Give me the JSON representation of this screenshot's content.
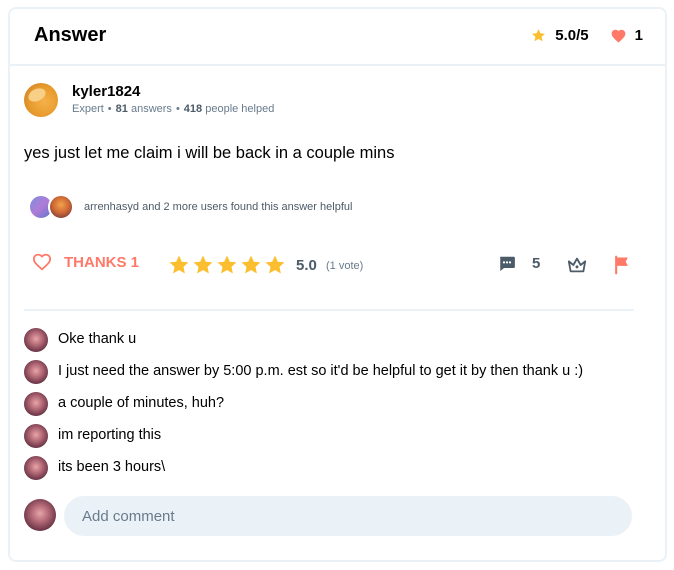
{
  "header": {
    "title": "Answer",
    "rating": "5.0/5",
    "thanks_count": "1",
    "star_color": "#fbbe2e",
    "heart_color": "#ff7968"
  },
  "author": {
    "name": "kyler1824",
    "rank": "Expert",
    "answers_count": "81",
    "answers_label": "answers",
    "helped_count": "418",
    "helped_label": "people helped"
  },
  "answer": {
    "text": "yes just let me claim i will be back in a couple mins"
  },
  "helpful": {
    "text": "arrenhasyd and 2 more users found this answer helpful"
  },
  "actions": {
    "thanks_label": "THANKS 1",
    "stars_filled": 5,
    "stars_total": 5,
    "rating_value": "5.0",
    "votes_label": "(1 vote)",
    "comments_count": "5",
    "accent_color": "#ff7968"
  },
  "comments": [
    {
      "text": "Oke thank u"
    },
    {
      "text": "I just need the answer by 5:00 p.m. est so it'd be helpful to get it by then thank u :)"
    },
    {
      "text": "a couple of minutes, huh?"
    },
    {
      "text": "im reporting this"
    },
    {
      "text": "its been 3 hours\\"
    }
  ],
  "add_comment": {
    "placeholder": "Add comment"
  }
}
